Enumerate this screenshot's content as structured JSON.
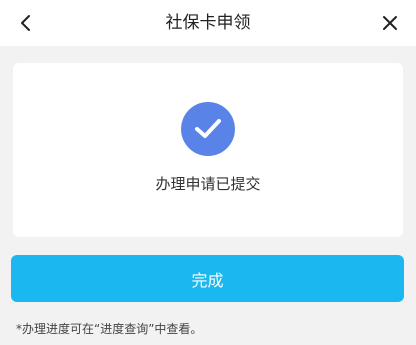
{
  "header": {
    "title": "社保卡申领",
    "back_icon": "chevron-left-icon",
    "close_icon": "close-icon"
  },
  "result": {
    "icon": "check-circle-icon",
    "status": "办理申请已提交"
  },
  "actions": {
    "done_label": "完成"
  },
  "footer": {
    "hint": "*办理进度可在“进度查询”中查看。"
  },
  "colors": {
    "accent": "#1ab7f0",
    "check": "#5a83e8",
    "background": "#f2f2f2"
  }
}
